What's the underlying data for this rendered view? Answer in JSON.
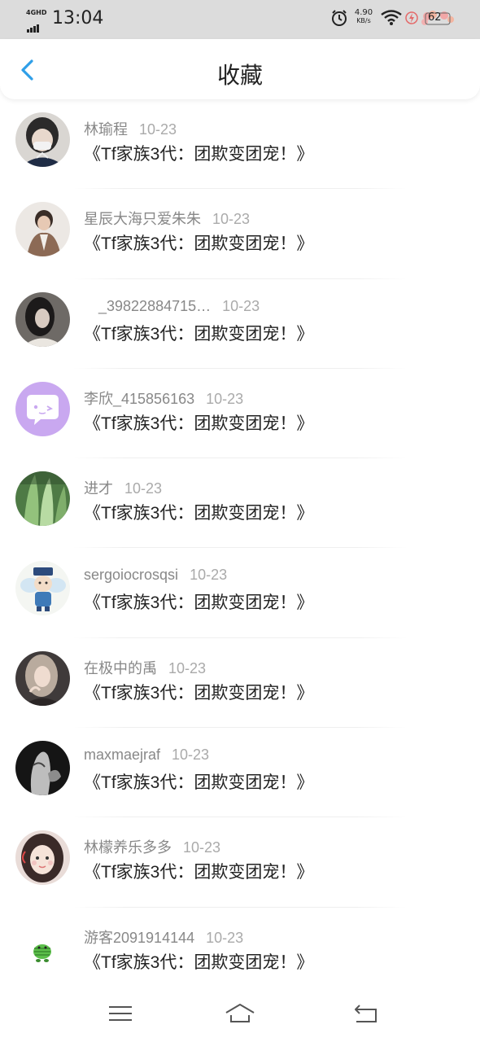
{
  "status_bar": {
    "network": "4GHD",
    "time": "13:04",
    "speed_value": "4.90",
    "speed_unit": "KB/s",
    "battery": "62",
    "icons": [
      "signal-icon",
      "alarm-icon",
      "wifi-icon",
      "charging-icon",
      "battery-icon"
    ]
  },
  "header": {
    "back_icon": "chevron-left-icon",
    "title": "收藏",
    "accent_color": "#2f9fe8"
  },
  "items": [
    {
      "user": "林瑜程",
      "date": "10-23",
      "title": "《Tf家族3代：团欺变团宠！》",
      "avatar": "photo-avatar"
    },
    {
      "user": "星辰大海只爱朱朱",
      "date": "10-23",
      "title": "《Tf家族3代：团欺变团宠！》",
      "avatar": "photo-avatar"
    },
    {
      "user": "_39822884715…",
      "date": "10-23",
      "title": "《Tf家族3代：团欺变团宠！》",
      "avatar": "photo-avatar"
    },
    {
      "user": "李欣_415856163",
      "date": "10-23",
      "title": "《Tf家族3代：团欺变团宠！》",
      "avatar": "default-chat-avatar"
    },
    {
      "user": "进才",
      "date": "10-23",
      "title": "《Tf家族3代：团欺变团宠！》",
      "avatar": "photo-avatar"
    },
    {
      "user": "sergoiocrosqsi",
      "date": "10-23",
      "title": "《Tf家族3代：团欺变团宠！》",
      "avatar": "cartoon-avatar"
    },
    {
      "user": "在极中的禹",
      "date": "10-23",
      "title": "《Tf家族3代：团欺变团宠！》",
      "avatar": "photo-avatar"
    },
    {
      "user": "maxmaejraf",
      "date": "10-23",
      "title": "《Tf家族3代：团欺变团宠！》",
      "avatar": "photo-avatar"
    },
    {
      "user": "林檬养乐多多",
      "date": "10-23",
      "title": "《Tf家族3代：团欺变团宠！》",
      "avatar": "photo-avatar"
    },
    {
      "user": "游客2091914144",
      "date": "10-23",
      "title": "《Tf家族3代：团欺变团宠！》",
      "avatar": "cartoon-avatar"
    }
  ],
  "navbar": {
    "icons": [
      "menu-icon",
      "home-icon",
      "back-icon"
    ]
  }
}
